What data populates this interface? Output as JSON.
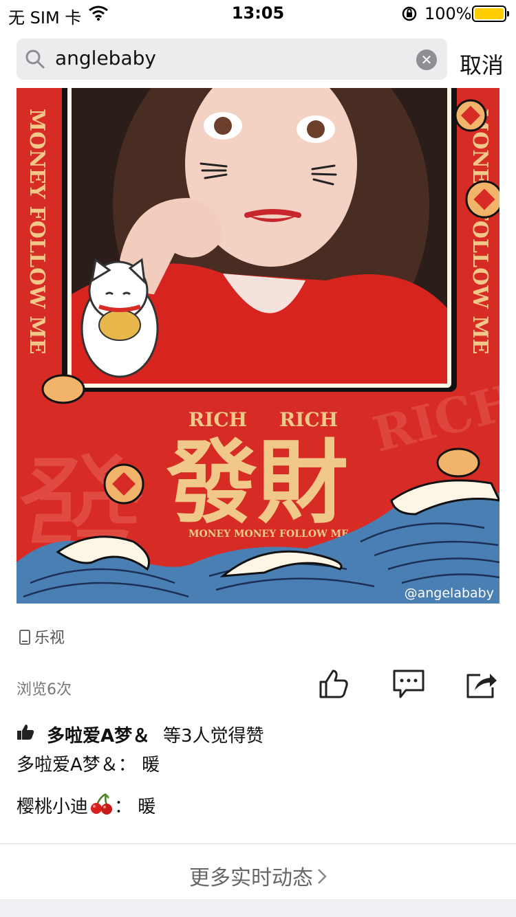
{
  "status_bar": {
    "carrier": "无 SIM 卡",
    "time": "13:05",
    "battery_percent": "100%",
    "battery_level": 1.0,
    "battery_color": "#ffcc00"
  },
  "search": {
    "query": "anglebaby",
    "cancel_label": "取消"
  },
  "photo": {
    "watermark": "@angelababy",
    "frame_text": "MONEY FOLLOW ME",
    "rich_word": "RICH",
    "chars": "發財",
    "subtitle": "MONEY MONEY FOLLOW ME",
    "background_color": "#d72b26"
  },
  "post": {
    "source": "乐视",
    "views": "浏览6次"
  },
  "likes": {
    "names": "多啦爱A梦＆",
    "suffix": "等3人觉得赞"
  },
  "comments": [
    {
      "author": "多啦爱A梦＆",
      "separator": "：",
      "text": "暖"
    },
    {
      "author": "樱桃小迪",
      "separator": "：",
      "text": "暖"
    }
  ],
  "more_label": "更多实时动态"
}
